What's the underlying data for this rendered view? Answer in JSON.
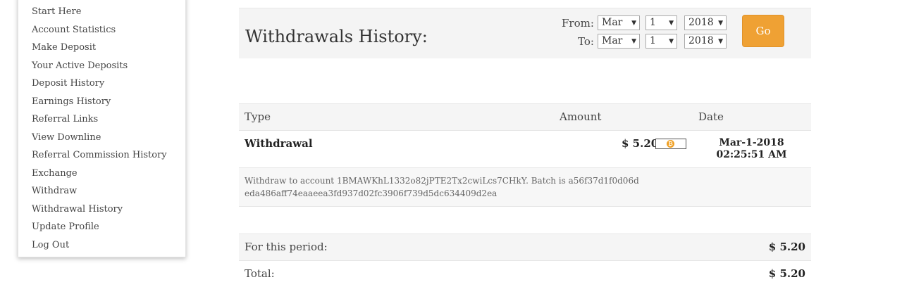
{
  "sidebar": {
    "items": [
      {
        "label": "Start Here"
      },
      {
        "label": "Account Statistics"
      },
      {
        "label": "Make Deposit"
      },
      {
        "label": "Your Active Deposits"
      },
      {
        "label": "Deposit History"
      },
      {
        "label": "Earnings History"
      },
      {
        "label": "Referral Links"
      },
      {
        "label": "View Downline"
      },
      {
        "label": "Referral Commission History"
      },
      {
        "label": "Exchange"
      },
      {
        "label": "Withdraw"
      },
      {
        "label": "Withdrawal History"
      },
      {
        "label": "Update Profile"
      },
      {
        "label": "Log Out"
      }
    ]
  },
  "header": {
    "title": "Withdrawals History:",
    "from_label": "From:",
    "to_label": "To:",
    "from": {
      "month": "Mar",
      "day": "1",
      "year": "2018"
    },
    "to": {
      "month": "Mar",
      "day": "1",
      "year": "2018"
    },
    "go_label": "Go",
    "go_color": "#efa134"
  },
  "table": {
    "columns": [
      "Type",
      "Amount",
      "Date"
    ],
    "rows": [
      {
        "type": "Withdrawal",
        "amount": "$ 5.20",
        "currency_icon": "bitcoin-icon",
        "date": "Mar-1-2018 02:25:51 AM",
        "description": "Withdraw to account 1BMAWKhL1332o82jPTE2Tx2cwiLcs7CHkY. Batch is a56f37d1f0d06deda486aff74eaaeea3fd937d02fc3906f739d5dc634409d2ea"
      }
    ]
  },
  "summary": {
    "period_label": "For this period:",
    "period_value": "$ 5.20",
    "total_label": "Total:",
    "total_value": "$ 5.20"
  }
}
